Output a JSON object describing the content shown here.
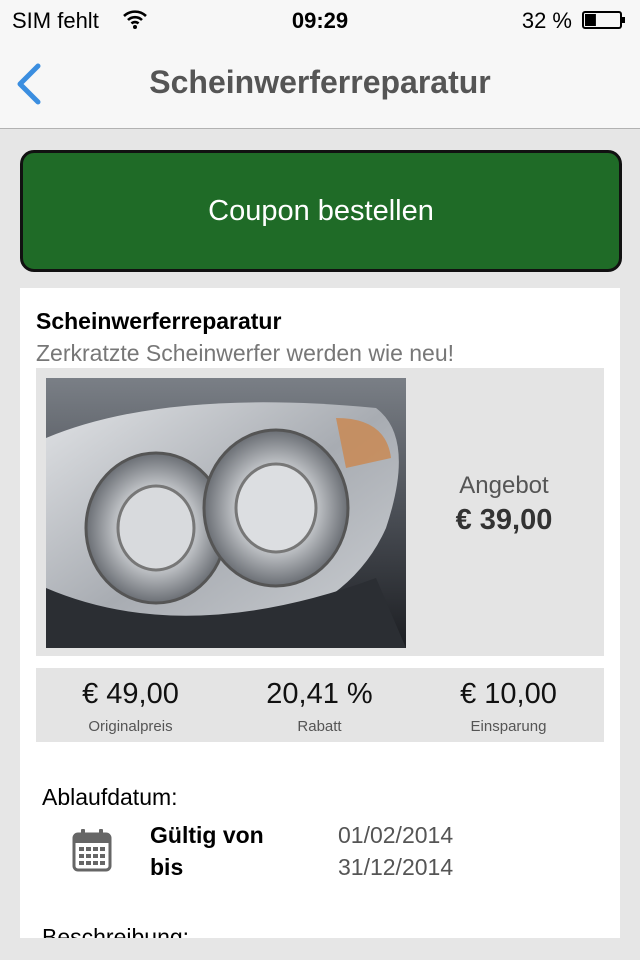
{
  "status_bar": {
    "carrier": "SIM fehlt",
    "time": "09:29",
    "battery_percent": "32 %",
    "wifi_icon": "wifi-icon",
    "battery_icon": "battery-icon",
    "battery_level": 0.32
  },
  "nav": {
    "title": "Scheinwerferreparatur",
    "back_icon": "chevron-left-icon"
  },
  "order_button": {
    "label": "Coupon bestellen"
  },
  "coupon": {
    "title": "Scheinwerferreparatur",
    "subtitle": "Zerkratzte Scheinwerfer werden wie neu!",
    "offer_label": "Angebot",
    "offer_price": "€ 39,00",
    "stats": [
      {
        "value": "€ 49,00",
        "label": "Originalpreis"
      },
      {
        "value": "20,41 %",
        "label": "Rabatt"
      },
      {
        "value": "€ 10,00",
        "label": "Einsparung"
      }
    ],
    "expiry_label": "Ablaufdatum:",
    "valid_from_label": "Gültig von",
    "valid_to_label": "bis",
    "valid_from": "01/02/2014",
    "valid_to": "31/12/2014",
    "description_label": "Beschreibung:",
    "calendar_icon": "calendar-icon"
  },
  "colors": {
    "accent_blue": "#3b8ee0",
    "button_green": "#1f6b27",
    "background": "#e6e6e6"
  }
}
